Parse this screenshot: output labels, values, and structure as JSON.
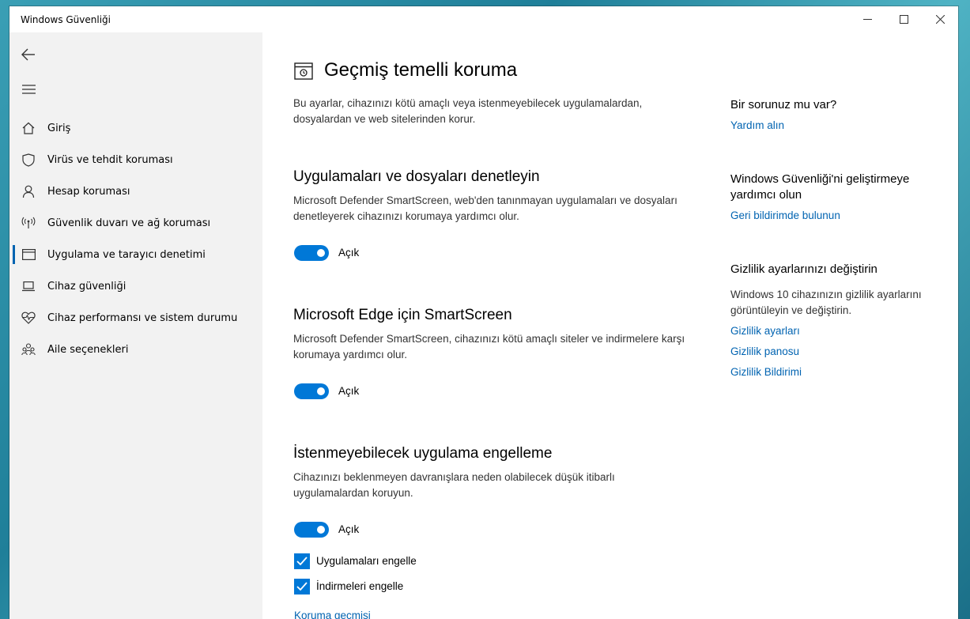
{
  "window": {
    "title": "Windows Güvenliği"
  },
  "sidebar": {
    "items": [
      {
        "label": "Giriş",
        "icon": "home-icon"
      },
      {
        "label": "Virüs ve tehdit koruması",
        "icon": "shield-icon"
      },
      {
        "label": "Hesap koruması",
        "icon": "person-icon"
      },
      {
        "label": "Güvenlik duvarı ve ağ koruması",
        "icon": "antenna-icon"
      },
      {
        "label": "Uygulama ve tarayıcı denetimi",
        "icon": "browser-window-icon",
        "active": true
      },
      {
        "label": "Cihaz güvenliği",
        "icon": "laptop-icon"
      },
      {
        "label": "Cihaz performansı ve sistem durumu",
        "icon": "heart-pulse-icon"
      },
      {
        "label": "Aile seçenekleri",
        "icon": "family-icon"
      }
    ]
  },
  "main": {
    "title": "Geçmiş temelli koruma",
    "description": "Bu ayarlar, cihazınızı kötü amaçlı veya istenmeyebilecek uygulamalardan, dosyalardan ve web sitelerinden korur.",
    "sections": [
      {
        "title": "Uygulamaları ve dosyaları denetleyin",
        "description": "Microsoft Defender SmartScreen, web'den tanınmayan uygulamaları ve dosyaları denetleyerek cihazınızı korumaya yardımcı olur.",
        "toggle_label": "Açık"
      },
      {
        "title": "Microsoft Edge için SmartScreen",
        "description": "Microsoft Defender SmartScreen, cihazınızı kötü amaçlı siteler ve indirmelere karşı korumaya yardımcı olur.",
        "toggle_label": "Açık"
      },
      {
        "title": "İstenmeyebilecek uygulama engelleme",
        "description": "Cihazınızı beklenmeyen davranışlara neden olabilecek düşük itibarlı uygulamalardan koruyun.",
        "toggle_label": "Açık",
        "checkboxes": [
          {
            "label": "Uygulamaları engelle"
          },
          {
            "label": "İndirmeleri engelle"
          }
        ],
        "link": "Koruma geçmişi"
      }
    ]
  },
  "right": {
    "help_title": "Bir sorunuz mu var?",
    "help_link": "Yardım alın",
    "improve_title": "Windows Güvenliği'ni geliştirmeye yardımcı olun",
    "improve_link": "Geri bildirimde bulunun",
    "privacy_title": "Gizlilik ayarlarınızı değiştirin",
    "privacy_text": "Windows 10 cihazınızın gizlilik ayarlarını görüntüleyin ve değiştirin.",
    "privacy_links": [
      "Gizlilik ayarları",
      "Gizlilik panosu",
      "Gizlilik Bildirimi"
    ]
  },
  "colors": {
    "accent": "#0078d7",
    "link": "#0063b1",
    "sidebar_bg": "#f2f2f2"
  }
}
